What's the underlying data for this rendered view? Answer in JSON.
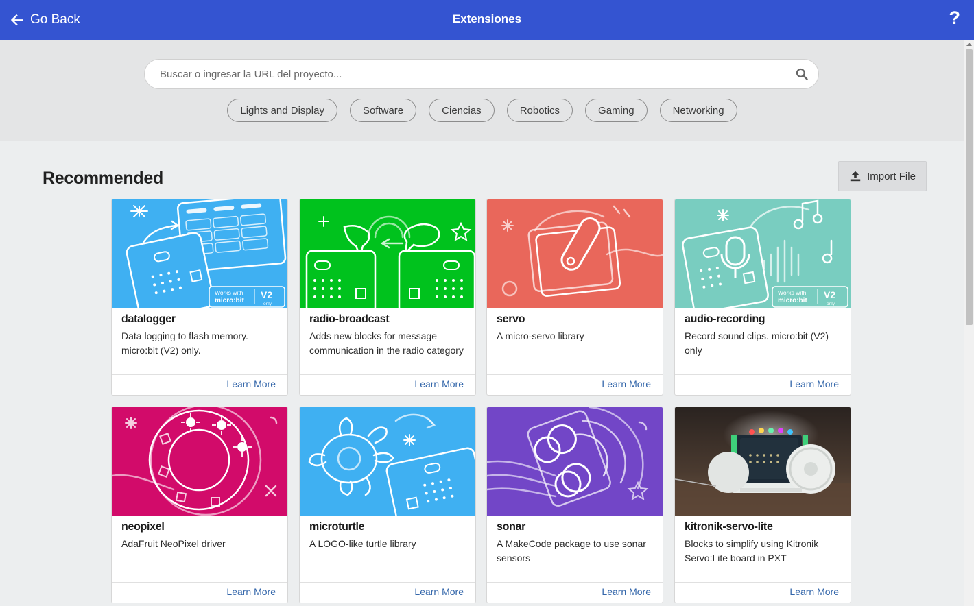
{
  "header": {
    "back_label": "Go Back",
    "title": "Extensiones",
    "help_label": "?"
  },
  "search": {
    "placeholder": "Buscar o ingresar la URL del proyecto...",
    "value": ""
  },
  "categories": [
    "Lights and Display",
    "Software",
    "Ciencias",
    "Robotics",
    "Gaming",
    "Networking"
  ],
  "section": {
    "title": "Recommended",
    "import_label": "Import File"
  },
  "badge": {
    "works_with": "Works with",
    "brand": "micro:bit",
    "version": "V2",
    "only": "only"
  },
  "cards": [
    {
      "name": "datalogger",
      "description": "Data logging to flash memory. micro:bit (V2) only.",
      "learn_more": "Learn More",
      "color": "#3fb0f2",
      "icon": "datalogger-art"
    },
    {
      "name": "radio-broadcast",
      "description": "Adds new blocks for message communication in the radio category",
      "learn_more": "Learn More",
      "color": "#00c21d",
      "icon": "radio-broadcast-art"
    },
    {
      "name": "servo",
      "description": "A micro-servo library",
      "learn_more": "Learn More",
      "color": "#e9675b",
      "icon": "servo-art"
    },
    {
      "name": "audio-recording",
      "description": "Record sound clips. micro:bit (V2) only",
      "learn_more": "Learn More",
      "color": "#79cdc0",
      "icon": "audio-recording-art"
    },
    {
      "name": "neopixel",
      "description": "AdaFruit NeoPixel driver",
      "learn_more": "Learn More",
      "color": "#d20b6a",
      "icon": "neopixel-art"
    },
    {
      "name": "microturtle",
      "description": "A LOGO-like turtle library",
      "learn_more": "Learn More",
      "color": "#3fb0f2",
      "icon": "turtle-art"
    },
    {
      "name": "sonar",
      "description": "A MakeCode package to use sonar sensors",
      "learn_more": "Learn More",
      "color": "#7246c7",
      "icon": "sonar-art"
    },
    {
      "name": "kitronik-servo-lite",
      "description": "Blocks to simplify using Kitronik Servo:Lite board in PXT",
      "learn_more": "Learn More",
      "color": "#3a2e26",
      "icon": "robot-photo"
    }
  ]
}
